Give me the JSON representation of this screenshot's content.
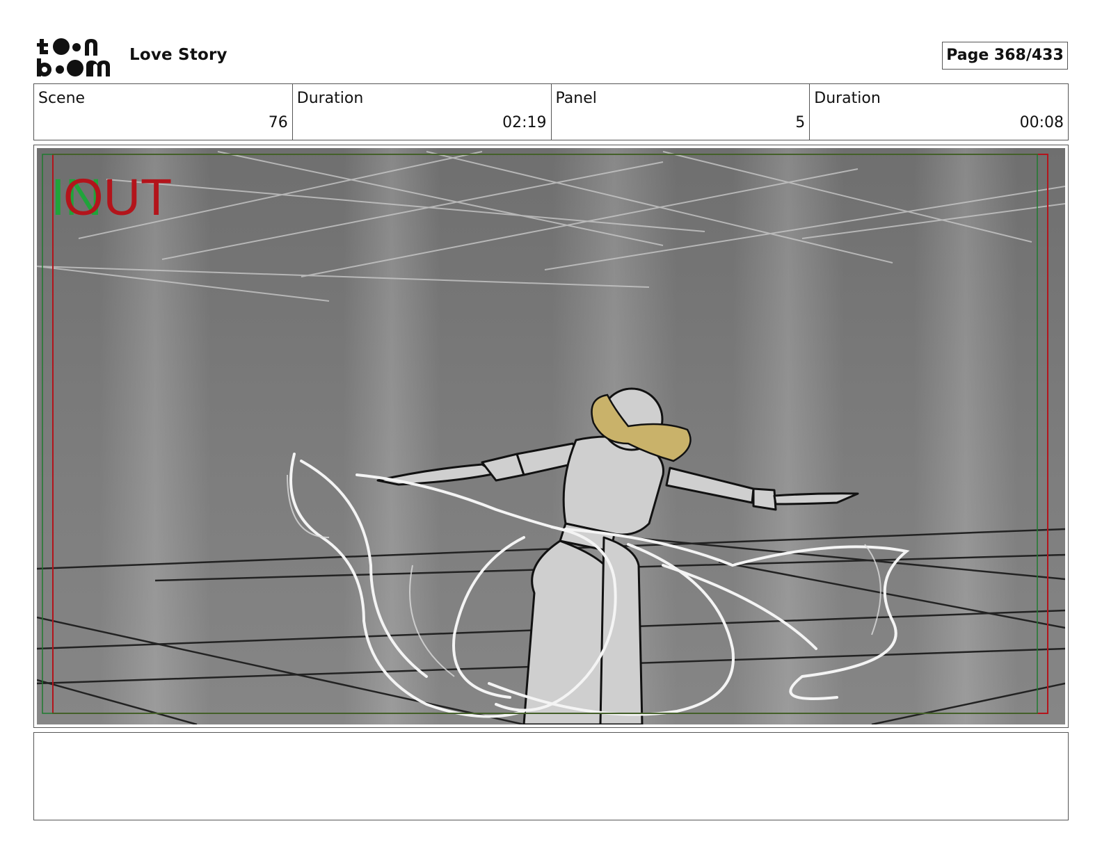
{
  "header": {
    "logo_text": "toon boom",
    "project_title": "Love Story",
    "page_label": "Page 368/433"
  },
  "info": [
    {
      "label": "Scene",
      "value": "76"
    },
    {
      "label": "Duration",
      "value": "02:19"
    },
    {
      "label": "Panel",
      "value": "5"
    },
    {
      "label": "Duration",
      "value": "00:08"
    }
  ],
  "panel": {
    "in_marker": "IN",
    "out_marker": "OUT",
    "colors": {
      "safe_frame": "#b3141b",
      "title_safe": "#1f7a2e",
      "hair": "#c9b26a"
    }
  },
  "notes": {
    "text": ""
  }
}
